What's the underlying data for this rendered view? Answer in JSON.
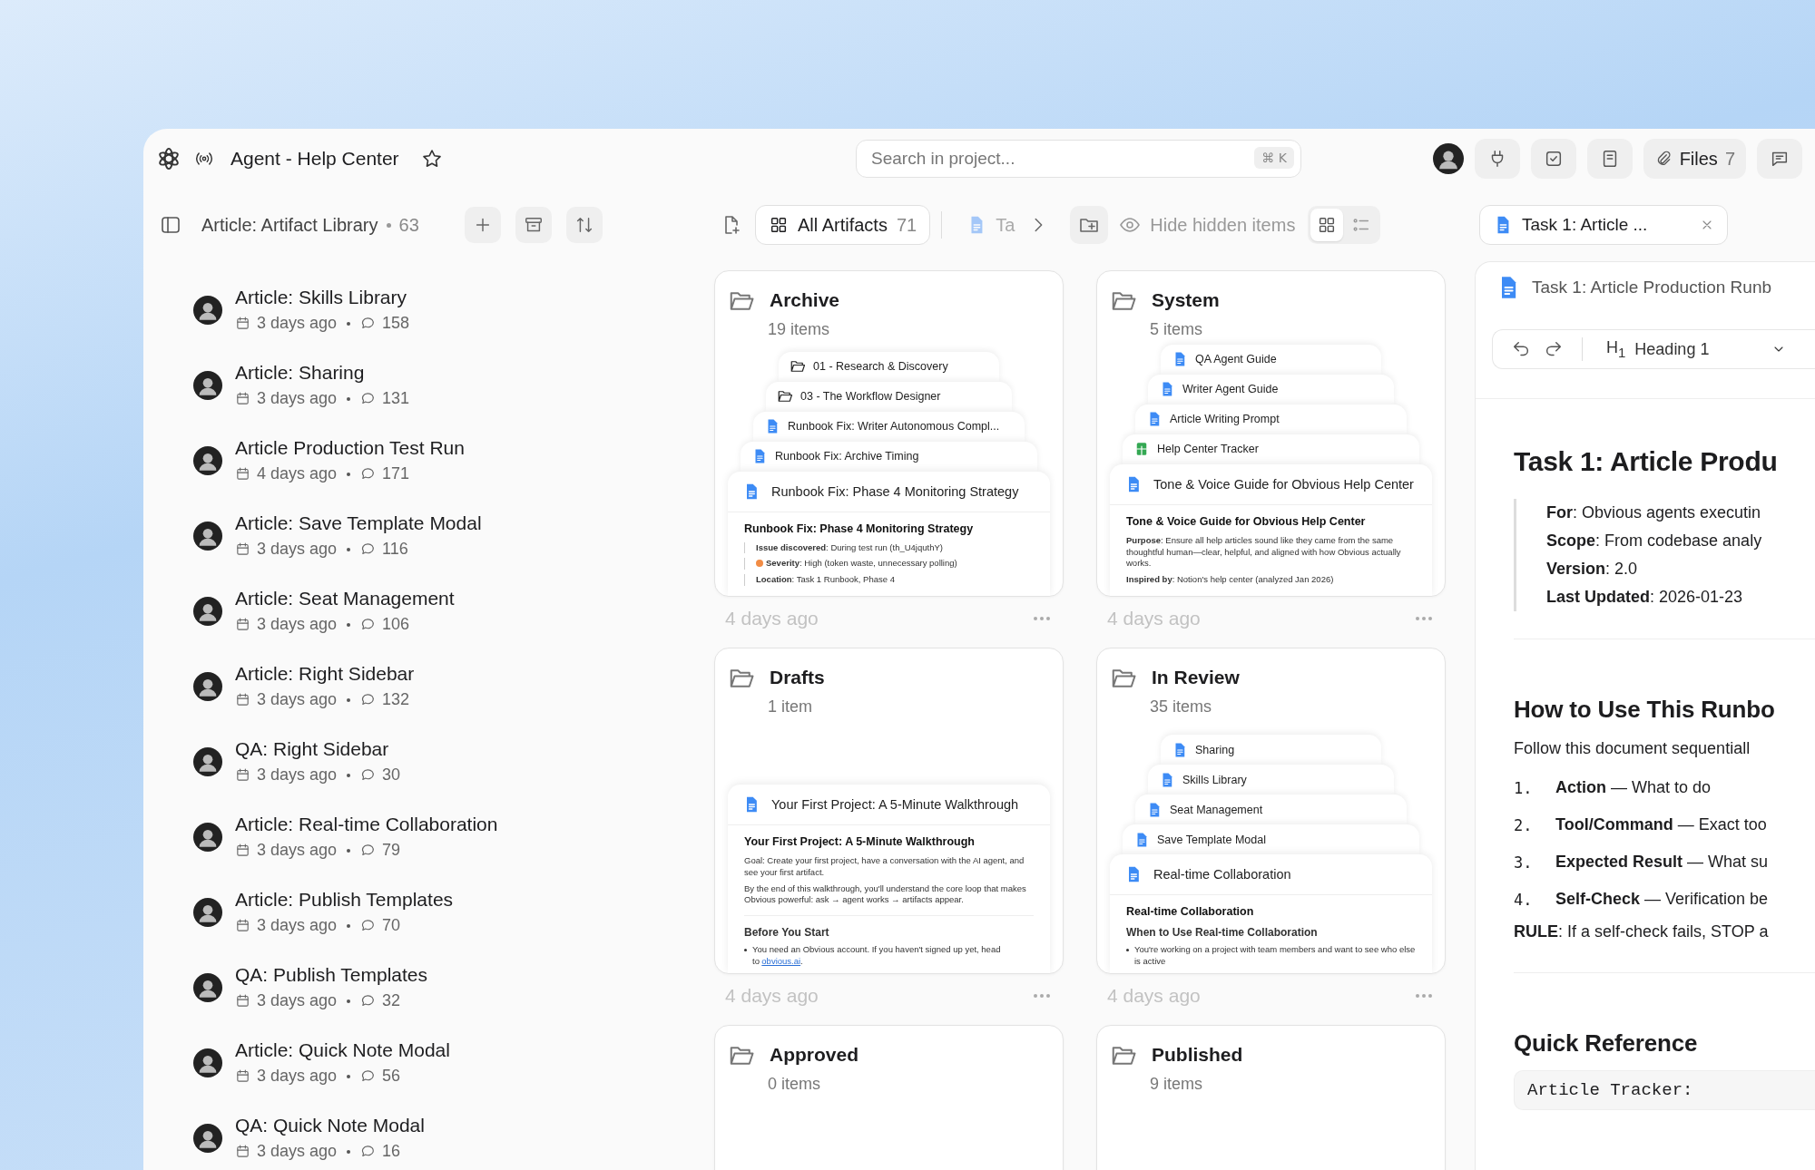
{
  "topbar": {
    "title": "Agent - Help Center",
    "search": {
      "placeholder": "Search in project...",
      "shortcut": "⌘ K"
    },
    "files": {
      "label": "Files",
      "count": "7"
    }
  },
  "sidebar": {
    "title": "Article: Artifact Library",
    "count": "63",
    "items": [
      {
        "title": "Article: Skills Library",
        "time": "3 days ago",
        "comments": "158"
      },
      {
        "title": "Article: Sharing",
        "time": "3 days ago",
        "comments": "131"
      },
      {
        "title": "Article Production Test Run",
        "time": "4 days ago",
        "comments": "171"
      },
      {
        "title": "Article: Save Template Modal",
        "time": "3 days ago",
        "comments": "116"
      },
      {
        "title": "Article: Seat Management",
        "time": "3 days ago",
        "comments": "106"
      },
      {
        "title": "Article: Right Sidebar",
        "time": "3 days ago",
        "comments": "132"
      },
      {
        "title": "QA: Right Sidebar",
        "time": "3 days ago",
        "comments": "30"
      },
      {
        "title": "Article: Real-time Collaboration",
        "time": "3 days ago",
        "comments": "79"
      },
      {
        "title": "Article: Publish Templates",
        "time": "3 days ago",
        "comments": "70"
      },
      {
        "title": "QA: Publish Templates",
        "time": "3 days ago",
        "comments": "32"
      },
      {
        "title": "Article: Quick Note Modal",
        "time": "3 days ago",
        "comments": "56"
      },
      {
        "title": "QA: Quick Note Modal",
        "time": "3 days ago",
        "comments": "16"
      }
    ]
  },
  "toolbar": {
    "tabs": [
      {
        "label": "All Artifacts",
        "count": "71",
        "selected": true
      },
      {
        "label": "Ta",
        "selected": false
      }
    ],
    "filter_label": "Hide hidden items",
    "view_modes": [
      {
        "kind": "grid",
        "selected": true
      },
      {
        "kind": "list",
        "selected": false
      }
    ]
  },
  "folders": [
    {
      "name": "Archive",
      "count": "19 items",
      "time": "4 days ago",
      "stack": [
        {
          "kind": "folder",
          "title": "01 - Research & Discovery"
        },
        {
          "kind": "folder",
          "title": "03 - The Workflow Designer"
        },
        {
          "kind": "doc",
          "title": "Runbook Fix: Writer Autonomous Compl..."
        },
        {
          "kind": "doc",
          "title": "Runbook Fix: Archive Timing"
        },
        {
          "kind": "doc",
          "title": "Runbook Fix: Phase 4 Monitoring Strategy"
        }
      ],
      "preview": {
        "title": "Runbook Fix: Phase 4 Monitoring Strategy",
        "blocks": [
          {
            "kind": "quote",
            "text": "**Issue discovered**: During test run (th_U4jquthY)"
          },
          {
            "kind": "quote",
            "text": "**Severity**: High (token waste, unnecessary polling)",
            "color": "#f28c45"
          },
          {
            "kind": "quote",
            "text": "**Location**: Task 1 Runbook, Phase 4"
          }
        ]
      }
    },
    {
      "name": "System",
      "count": "5 items",
      "time": "4 days ago",
      "stack": [
        {
          "kind": "doc",
          "title": "QA Agent Guide"
        },
        {
          "kind": "doc",
          "title": "Writer Agent Guide"
        },
        {
          "kind": "doc",
          "title": "Article Writing Prompt"
        },
        {
          "kind": "sheet",
          "title": "Help Center Tracker"
        },
        {
          "kind": "doc",
          "title": "Tone & Voice Guide for Obvious Help Center"
        }
      ],
      "preview": {
        "title": "Tone & Voice Guide for Obvious Help Center",
        "blocks": [
          {
            "kind": "para",
            "text": "**Purpose**: Ensure all help articles sound like they came from the same thoughtful human—clear, helpful, and aligned with how Obvious actually works."
          },
          {
            "kind": "para",
            "text": "**Inspired by**: Notion's help center (analyzed Jan 2026)"
          }
        ]
      }
    },
    {
      "name": "Drafts",
      "count": "1 item",
      "time": "4 days ago",
      "stack": [
        {
          "kind": "doc",
          "title": "Your First Project: A 5-Minute Walkthrough"
        }
      ],
      "preview": {
        "title": "Your First Project: A 5-Minute Walkthrough",
        "blocks": [
          {
            "kind": "para",
            "text": "Goal: Create your first project, have a conversation with the AI agent, and see your first artifact."
          },
          {
            "kind": "para",
            "text": "By the end of this walkthrough, you'll understand the core loop that makes Obvious powerful: ask → agent works → artifacts appear."
          },
          {
            "kind": "rule"
          },
          {
            "kind": "h3",
            "text": "Before You Start"
          },
          {
            "kind": "bullet",
            "text": "You need an Obvious account. If you haven't signed up yet, head to",
            "link": "obvious.ai",
            "after": "."
          }
        ]
      }
    },
    {
      "name": "In Review",
      "count": "35 items",
      "time": "4 days ago",
      "stack": [
        {
          "kind": "doc",
          "title": "Sharing"
        },
        {
          "kind": "doc",
          "title": "Skills Library"
        },
        {
          "kind": "doc",
          "title": "Seat Management"
        },
        {
          "kind": "doc",
          "title": "Save Template Modal"
        },
        {
          "kind": "doc",
          "title": "Real-time Collaboration"
        }
      ],
      "preview": {
        "title": "Real-time Collaboration",
        "blocks": [
          {
            "kind": "h3",
            "text": "When to Use Real-time Collaboration"
          },
          {
            "kind": "bullet",
            "text": "You're working on a project with team members and want to see who else is active"
          }
        ]
      }
    },
    {
      "name": "Approved",
      "count": "0 items"
    },
    {
      "name": "Published",
      "count": "9 items"
    }
  ],
  "editor": {
    "tab": "Task 1: Article ...",
    "doc_title": "Task 1: Article Production Runb",
    "block_type": {
      "marker": "H$_{1}$",
      "label": "Heading 1"
    },
    "blocks": [
      {
        "kind": "h1",
        "text": "Task 1: Article Produ"
      },
      {
        "kind": "quote",
        "lines": [
          "**For**: Obvious agents executin",
          "**Scope**: From codebase analy",
          "**Version**: 2.0",
          "**Last Updated**: 2026-01-23"
        ]
      },
      {
        "kind": "rule"
      },
      {
        "kind": "h2",
        "text": "How to Use This Runbo"
      },
      {
        "kind": "para",
        "text": "Follow this document sequentiall"
      },
      {
        "kind": "numbered",
        "items": [
          {
            "number": "1.",
            "text": "**Action** — What to do"
          },
          {
            "number": "2.",
            "text": "**Tool/Command** — Exact too"
          },
          {
            "number": "3.",
            "text": "**Expected Result** — What su"
          },
          {
            "number": "4.",
            "text": "**Self-Check** — Verification be"
          }
        ]
      },
      {
        "kind": "para",
        "text": "**RULE**: If a self-check fails, STOP a"
      },
      {
        "kind": "rule"
      },
      {
        "kind": "h2",
        "text": "Quick Reference"
      },
      {
        "kind": "code",
        "text": "Article Tracker:"
      }
    ]
  }
}
